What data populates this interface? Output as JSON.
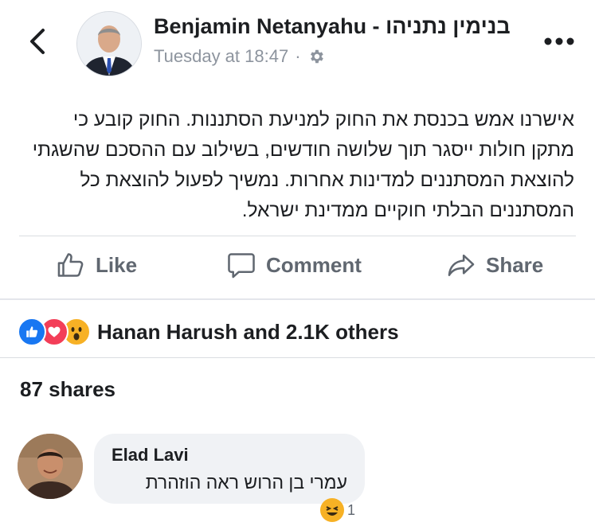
{
  "header": {
    "title": "Benjamin Netanyahu - בנימין נתניהו",
    "timestamp": "Tuesday at 18:47",
    "separator": "·",
    "privacy_icon": "gear-icon",
    "back_icon": "chevron-left-icon",
    "more_icon": "more-horizontal-icon"
  },
  "post": {
    "text": "אישרנו אמש בכנסת את החוק למניעת הסתננות. החוק קובע כי מתקן חולות ייסגר תוך שלושה חודשים, בשילוב עם ההסכם שהשגתי להוצאת המסתננים למדינות אחרות. נמשיך לפעול להוצאת כל המסתננים הבלתי חוקיים ממדינת ישראל."
  },
  "actions": {
    "like": "Like",
    "comment": "Comment",
    "share": "Share"
  },
  "reactions": {
    "types": [
      "like",
      "love",
      "wow"
    ],
    "summary": "Hanan Harush and 2.1K others"
  },
  "shares": {
    "label": "87 shares"
  },
  "comment": {
    "author": "Elad Lavi",
    "text": "עמרי בן הרוש ראה הוזהרת",
    "reaction_count": "1"
  },
  "colors": {
    "facebook_blue": "#1877f2",
    "love_red": "#f33e58",
    "wow_yellow": "#f7b125",
    "meta_gray": "#8d949e",
    "action_gray": "#606770"
  }
}
